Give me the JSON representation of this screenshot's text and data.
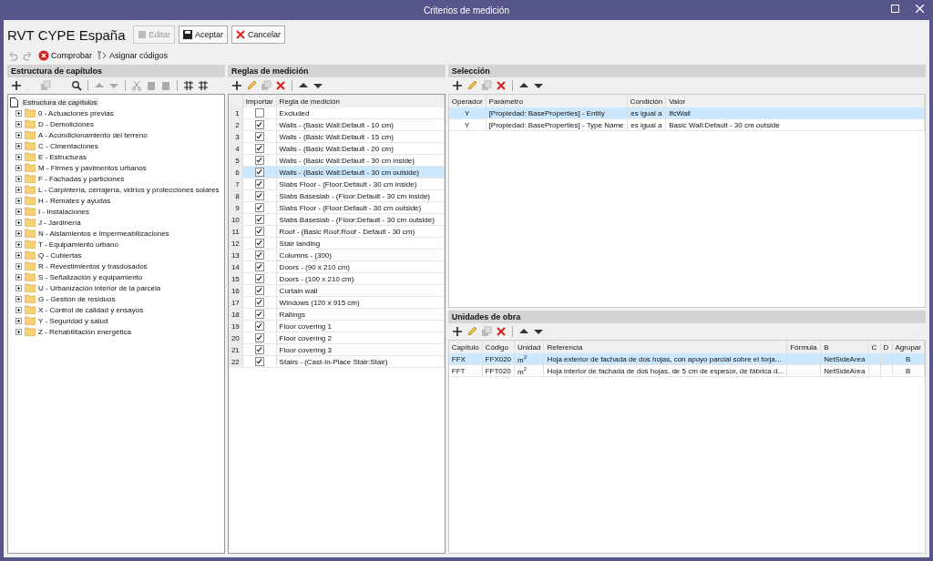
{
  "window": {
    "title": "Criterios de medición"
  },
  "header": {
    "title": "RVT CYPE España",
    "buttons": [
      {
        "label": "Editar",
        "kind": "edit",
        "disabled": true
      },
      {
        "label": "Aceptar",
        "kind": "save",
        "disabled": false
      },
      {
        "label": "Cancelar",
        "kind": "cancel",
        "disabled": false
      }
    ]
  },
  "toolbar": {
    "check": "Comprobar",
    "assign": "Asignar códigos"
  },
  "chapters": {
    "title": "Estructura de capítulos",
    "root": "Estructura de capítulos",
    "items": [
      {
        "label": "0 - Actuaciones previas"
      },
      {
        "label": "D - Demoliciones"
      },
      {
        "label": "A - Acondicionamiento del terreno"
      },
      {
        "label": "C - Cimentaciones"
      },
      {
        "label": "E - Estructuras"
      },
      {
        "label": "M - Firmes y pavimentos urbanos"
      },
      {
        "label": "F - Fachadas y particiones"
      },
      {
        "label": "L - Carpintería, cerrajería, vidrios y protecciones solares"
      },
      {
        "label": "H - Remates y ayudas"
      },
      {
        "label": "I - Instalaciones"
      },
      {
        "label": "J - Jardinería"
      },
      {
        "label": "N - Aislamientos e impermeabilizaciones"
      },
      {
        "label": "T - Equipamiento urbano"
      },
      {
        "label": "Q - Cubiertas"
      },
      {
        "label": "R - Revestimientos y trasdosados"
      },
      {
        "label": "S - Señalización y equipamiento"
      },
      {
        "label": "U - Urbanización interior de la parcela"
      },
      {
        "label": "G - Gestión de residuos"
      },
      {
        "label": "X - Control de calidad y ensayos"
      },
      {
        "label": "Y - Seguridad y salud"
      },
      {
        "label": "Z - Rehabilitación energética"
      }
    ]
  },
  "rules": {
    "title": "Reglas de medición",
    "columns": [
      "Importar",
      "Regla de medición"
    ],
    "rows": [
      {
        "number": "1",
        "checked": false,
        "rule": "Excluded",
        "selected": false
      },
      {
        "number": "2",
        "checked": true,
        "rule": "Walls - (Basic Wall:Default - 10 cm)",
        "selected": false
      },
      {
        "number": "3",
        "checked": true,
        "rule": "Walls - (Basic Wall:Default - 15 cm)",
        "selected": false
      },
      {
        "number": "4",
        "checked": true,
        "rule": "Walls - (Basic Wall:Default - 20 cm)",
        "selected": false
      },
      {
        "number": "5",
        "checked": true,
        "rule": "Walls - (Basic Wall:Default - 30 cm inside)",
        "selected": false
      },
      {
        "number": "6",
        "checked": true,
        "rule": "Walls - (Basic Wall:Default - 30 cm outside)",
        "selected": true
      },
      {
        "number": "7",
        "checked": true,
        "rule": "Slabs Floor - (Floor:Default - 30 cm inside)",
        "selected": false
      },
      {
        "number": "8",
        "checked": true,
        "rule": "Slabs Baseslab - (Floor:Default - 30 cm inside)",
        "selected": false
      },
      {
        "number": "9",
        "checked": true,
        "rule": "Slabs Floor - (Floor:Default - 30 cm outside)",
        "selected": false
      },
      {
        "number": "10",
        "checked": true,
        "rule": "Slabs Baseslab - (Floor:Default - 30 cm outside)",
        "selected": false
      },
      {
        "number": "11",
        "checked": true,
        "rule": "Roof - (Basic Roof:Roof - Default - 30 cm)",
        "selected": false
      },
      {
        "number": "12",
        "checked": true,
        "rule": "Stair landing",
        "selected": false
      },
      {
        "number": "13",
        "checked": true,
        "rule": "Columns - (300)",
        "selected": false
      },
      {
        "number": "14",
        "checked": true,
        "rule": "Doors - (90 x 210 cm)",
        "selected": false
      },
      {
        "number": "15",
        "checked": true,
        "rule": "Doors - (100 x 210 cm)",
        "selected": false
      },
      {
        "number": "16",
        "checked": true,
        "rule": "Curtain wall",
        "selected": false
      },
      {
        "number": "17",
        "checked": true,
        "rule": "Windows (120 x 915 cm)",
        "selected": false
      },
      {
        "number": "18",
        "checked": true,
        "rule": "Railings",
        "selected": false
      },
      {
        "number": "19",
        "checked": true,
        "rule": "Floor covering 1",
        "selected": false
      },
      {
        "number": "20",
        "checked": true,
        "rule": "Floor covering 2",
        "selected": false
      },
      {
        "number": "21",
        "checked": true,
        "rule": "Floor covering 3",
        "selected": false
      },
      {
        "number": "22",
        "checked": true,
        "rule": "Stairs - (Cast-In-Place Stair:Stair)",
        "selected": false
      }
    ]
  },
  "selection": {
    "title": "Selección",
    "columns": [
      "Operador",
      "Parámetro",
      "Condición",
      "Valor"
    ],
    "rows": [
      {
        "operator": "Y",
        "parameter": "[Propiedad: BaseProperties] - Entity",
        "condition": "es igual a",
        "value": "IfcWall",
        "selected": true
      },
      {
        "operator": "Y",
        "parameter": "[Propiedad: BaseProperties] - Type Name",
        "condition": "es igual a",
        "value": "Basic Wall:Default - 30 cm outside",
        "selected": false
      }
    ]
  },
  "units": {
    "title": "Unidades de obra",
    "columns": [
      "Capítulo",
      "Código",
      "Unidad",
      "Referencia",
      "Fórmula",
      "B",
      "C",
      "D",
      "Agrupar"
    ],
    "rows": [
      {
        "chapter": "FFX",
        "code": "FFX020",
        "unit": "m$^{2}$",
        "reference": "Hoja exterior de fachada de dos hojas, con apoyo parcial sobre el forja...",
        "b": "NetSideArea",
        "group": "B",
        "selected": true
      },
      {
        "chapter": "FFT",
        "code": "FFT020",
        "unit": "m$^{2}$",
        "reference": "Hoja interior de fachada de dos hojas, de 5 cm de espesor, de fábrica d...",
        "b": "NetSideArea",
        "group": "B",
        "selected": false
      }
    ]
  }
}
